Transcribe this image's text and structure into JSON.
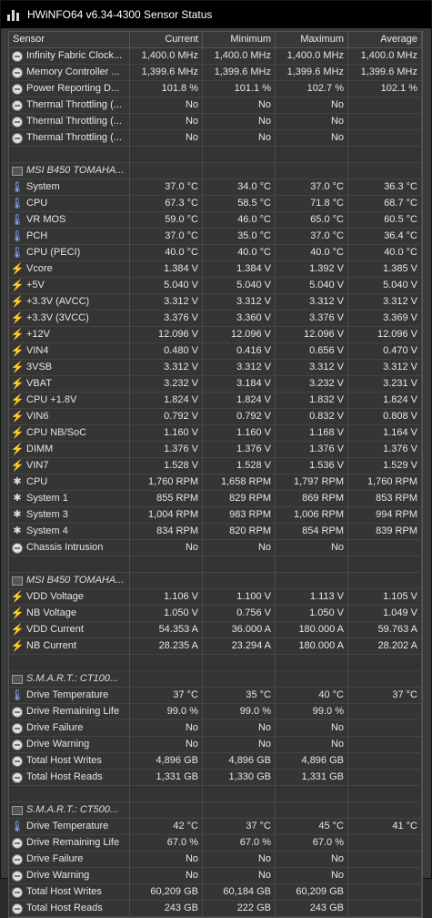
{
  "window": {
    "title": "HWiNFO64 v6.34-4300 Sensor Status"
  },
  "columns": [
    "Sensor",
    "Current",
    "Minimum",
    "Maximum",
    "Average"
  ],
  "rows": [
    {
      "icon": "gauge",
      "name": "Infinity Fabric Clock...",
      "cur": "1,400.0 MHz",
      "min": "1,400.0 MHz",
      "max": "1,400.0 MHz",
      "avg": "1,400.0 MHz"
    },
    {
      "icon": "gauge",
      "name": "Memory Controller ...",
      "cur": "1,399.6 MHz",
      "min": "1,399.6 MHz",
      "max": "1,399.6 MHz",
      "avg": "1,399.6 MHz"
    },
    {
      "icon": "gauge",
      "name": "Power Reporting D...",
      "cur": "101.8 %",
      "min": "101.1 %",
      "max": "102.7 %",
      "avg": "102.1 %"
    },
    {
      "icon": "gauge",
      "name": "Thermal Throttling (...",
      "cur": "No",
      "min": "No",
      "max": "No",
      "avg": ""
    },
    {
      "icon": "gauge",
      "name": "Thermal Throttling (...",
      "cur": "No",
      "min": "No",
      "max": "No",
      "avg": ""
    },
    {
      "icon": "gauge",
      "name": "Thermal Throttling (...",
      "cur": "No",
      "min": "No",
      "max": "No",
      "avg": ""
    },
    {
      "type": "empty"
    },
    {
      "type": "group",
      "icon": "chip",
      "name": "MSI B450 TOMAHA..."
    },
    {
      "icon": "thermometer",
      "name": "System",
      "cur": "37.0 °C",
      "min": "34.0 °C",
      "max": "37.0 °C",
      "avg": "36.3 °C"
    },
    {
      "icon": "thermometer",
      "name": "CPU",
      "cur": "67.3 °C",
      "min": "58.5 °C",
      "max": "71.8 °C",
      "avg": "68.7 °C"
    },
    {
      "icon": "thermometer",
      "name": "VR MOS",
      "cur": "59.0 °C",
      "min": "46.0 °C",
      "max": "65.0 °C",
      "avg": "60.5 °C"
    },
    {
      "icon": "thermometer",
      "name": "PCH",
      "cur": "37.0 °C",
      "min": "35.0 °C",
      "max": "37.0 °C",
      "avg": "36.4 °C"
    },
    {
      "icon": "thermometer",
      "name": "CPU (PECI)",
      "cur": "40.0 °C",
      "min": "40.0 °C",
      "max": "40.0 °C",
      "avg": "40.0 °C"
    },
    {
      "icon": "bolt",
      "name": "Vcore",
      "cur": "1.384 V",
      "min": "1.384 V",
      "max": "1.392 V",
      "avg": "1.385 V"
    },
    {
      "icon": "bolt",
      "name": "+5V",
      "cur": "5.040 V",
      "min": "5.040 V",
      "max": "5.040 V",
      "avg": "5.040 V"
    },
    {
      "icon": "bolt",
      "name": "+3.3V (AVCC)",
      "cur": "3.312 V",
      "min": "3.312 V",
      "max": "3.312 V",
      "avg": "3.312 V"
    },
    {
      "icon": "bolt",
      "name": "+3.3V (3VCC)",
      "cur": "3.376 V",
      "min": "3.360 V",
      "max": "3.376 V",
      "avg": "3.369 V"
    },
    {
      "icon": "bolt",
      "name": "+12V",
      "cur": "12.096 V",
      "min": "12.096 V",
      "max": "12.096 V",
      "avg": "12.096 V"
    },
    {
      "icon": "bolt",
      "name": "VIN4",
      "cur": "0.480 V",
      "min": "0.416 V",
      "max": "0.656 V",
      "avg": "0.470 V"
    },
    {
      "icon": "bolt",
      "name": "3VSB",
      "cur": "3.312 V",
      "min": "3.312 V",
      "max": "3.312 V",
      "avg": "3.312 V"
    },
    {
      "icon": "bolt",
      "name": "VBAT",
      "cur": "3.232 V",
      "min": "3.184 V",
      "max": "3.232 V",
      "avg": "3.231 V"
    },
    {
      "icon": "bolt",
      "name": "CPU +1.8V",
      "cur": "1.824 V",
      "min": "1.824 V",
      "max": "1.832 V",
      "avg": "1.824 V"
    },
    {
      "icon": "bolt",
      "name": "VIN6",
      "cur": "0.792 V",
      "min": "0.792 V",
      "max": "0.832 V",
      "avg": "0.808 V"
    },
    {
      "icon": "bolt",
      "name": "CPU NB/SoC",
      "cur": "1.160 V",
      "min": "1.160 V",
      "max": "1.168 V",
      "avg": "1.164 V"
    },
    {
      "icon": "bolt",
      "name": "DIMM",
      "cur": "1.376 V",
      "min": "1.376 V",
      "max": "1.376 V",
      "avg": "1.376 V"
    },
    {
      "icon": "bolt",
      "name": "VIN7",
      "cur": "1.528 V",
      "min": "1.528 V",
      "max": "1.536 V",
      "avg": "1.529 V"
    },
    {
      "icon": "fan",
      "name": "CPU",
      "cur": "1,760 RPM",
      "min": "1,658 RPM",
      "max": "1,797 RPM",
      "avg": "1,760 RPM"
    },
    {
      "icon": "fan",
      "name": "System 1",
      "cur": "855 RPM",
      "min": "829 RPM",
      "max": "869 RPM",
      "avg": "853 RPM"
    },
    {
      "icon": "fan",
      "name": "System 3",
      "cur": "1,004 RPM",
      "min": "983 RPM",
      "max": "1,006 RPM",
      "avg": "994 RPM"
    },
    {
      "icon": "fan",
      "name": "System 4",
      "cur": "834 RPM",
      "min": "820 RPM",
      "max": "854 RPM",
      "avg": "839 RPM"
    },
    {
      "icon": "gauge",
      "name": "Chassis Intrusion",
      "cur": "No",
      "min": "No",
      "max": "No",
      "avg": ""
    },
    {
      "type": "empty"
    },
    {
      "type": "group",
      "icon": "chip",
      "name": "MSI B450 TOMAHA..."
    },
    {
      "icon": "bolt",
      "name": "VDD Voltage",
      "cur": "1.106 V",
      "min": "1.100 V",
      "max": "1.113 V",
      "avg": "1.105 V"
    },
    {
      "icon": "bolt",
      "name": "NB Voltage",
      "cur": "1.050 V",
      "min": "0.756 V",
      "max": "1.050 V",
      "avg": "1.049 V"
    },
    {
      "icon": "bolt",
      "name": "VDD Current",
      "cur": "54.353 A",
      "min": "36.000 A",
      "max": "180.000 A",
      "avg": "59.763 A"
    },
    {
      "icon": "bolt",
      "name": "NB Current",
      "cur": "28.235 A",
      "min": "23.294 A",
      "max": "180.000 A",
      "avg": "28.202 A"
    },
    {
      "type": "empty"
    },
    {
      "type": "group",
      "icon": "chip",
      "name": "S.M.A.R.T.: CT100..."
    },
    {
      "icon": "thermometer",
      "name": "Drive Temperature",
      "cur": "37 °C",
      "min": "35 °C",
      "max": "40 °C",
      "avg": "37 °C"
    },
    {
      "icon": "gauge",
      "name": "Drive Remaining Life",
      "cur": "99.0 %",
      "min": "99.0 %",
      "max": "99.0 %",
      "avg": ""
    },
    {
      "icon": "gauge",
      "name": "Drive Failure",
      "cur": "No",
      "min": "No",
      "max": "No",
      "avg": ""
    },
    {
      "icon": "gauge",
      "name": "Drive Warning",
      "cur": "No",
      "min": "No",
      "max": "No",
      "avg": ""
    },
    {
      "icon": "gauge",
      "name": "Total Host Writes",
      "cur": "4,896 GB",
      "min": "4,896 GB",
      "max": "4,896 GB",
      "avg": ""
    },
    {
      "icon": "gauge",
      "name": "Total Host Reads",
      "cur": "1,331 GB",
      "min": "1,330 GB",
      "max": "1,331 GB",
      "avg": ""
    },
    {
      "type": "empty"
    },
    {
      "type": "group",
      "icon": "chip",
      "name": "S.M.A.R.T.: CT500..."
    },
    {
      "icon": "thermometer",
      "name": "Drive Temperature",
      "cur": "42 °C",
      "min": "37 °C",
      "max": "45 °C",
      "avg": "41 °C"
    },
    {
      "icon": "gauge",
      "name": "Drive Remaining Life",
      "cur": "67.0 %",
      "min": "67.0 %",
      "max": "67.0 %",
      "avg": ""
    },
    {
      "icon": "gauge",
      "name": "Drive Failure",
      "cur": "No",
      "min": "No",
      "max": "No",
      "avg": ""
    },
    {
      "icon": "gauge",
      "name": "Drive Warning",
      "cur": "No",
      "min": "No",
      "max": "No",
      "avg": ""
    },
    {
      "icon": "gauge",
      "name": "Total Host Writes",
      "cur": "60,209 GB",
      "min": "60,184 GB",
      "max": "60,209 GB",
      "avg": ""
    },
    {
      "icon": "gauge",
      "name": "Total Host Reads",
      "cur": "243 GB",
      "min": "222 GB",
      "max": "243 GB",
      "avg": ""
    }
  ]
}
